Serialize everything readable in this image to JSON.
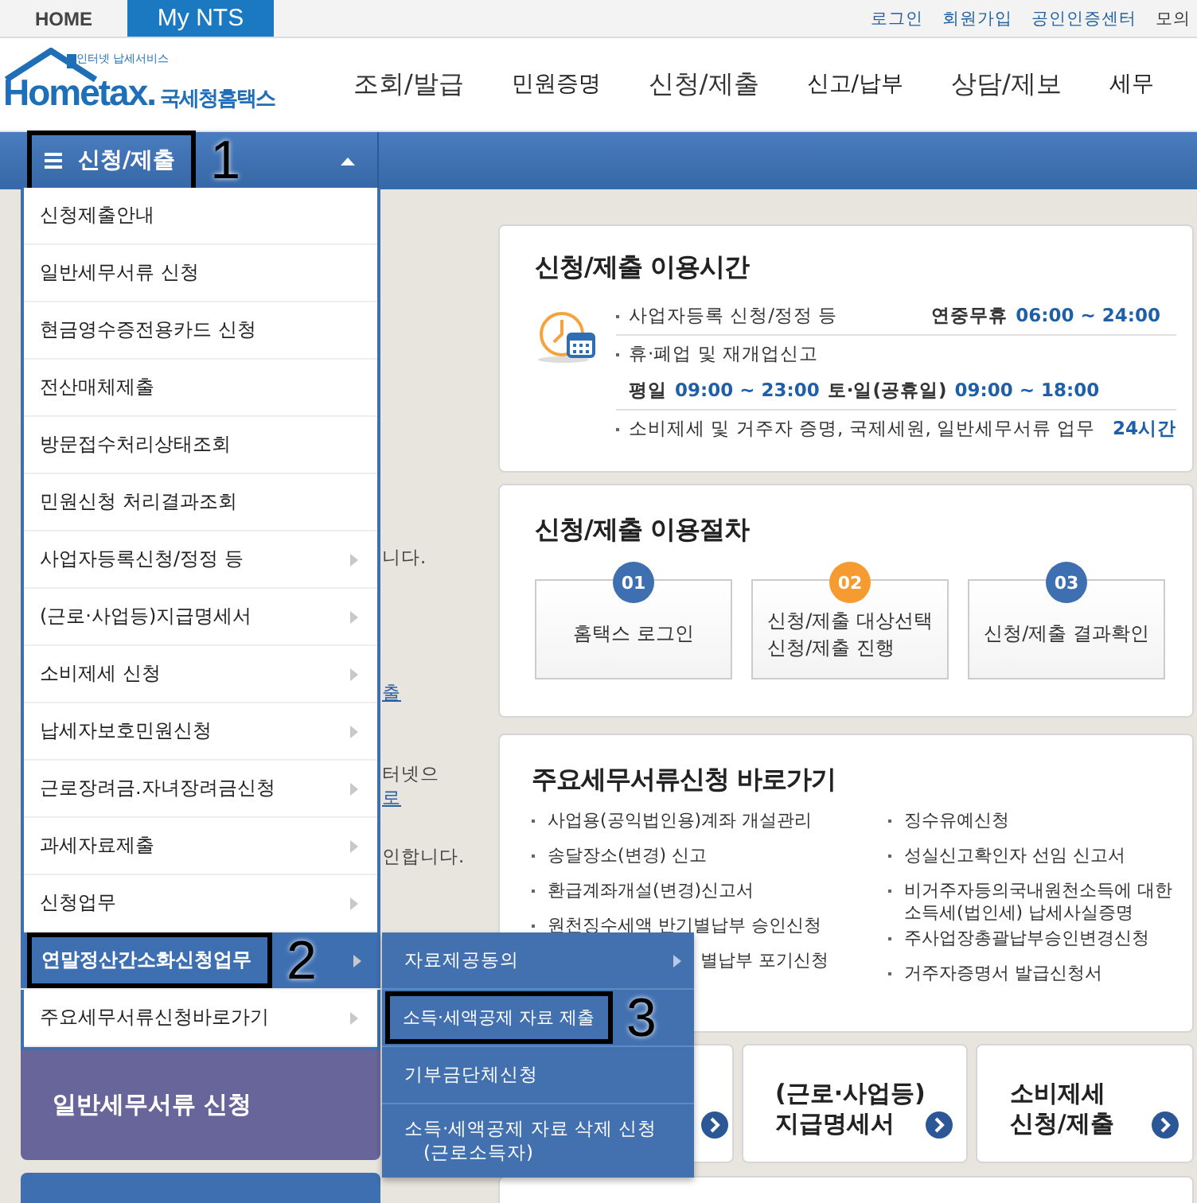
{
  "top_bar": {
    "tabs": [
      {
        "label": "HOME",
        "selected": false
      },
      {
        "label": "My NTS",
        "selected": true
      }
    ],
    "links": [
      "로그인",
      "회원가입",
      "공인인증센터",
      "모의"
    ]
  },
  "header": {
    "logo": {
      "brand": "Hometax.",
      "name": "국세청홈택스",
      "tagline": "인터넷 납세서비스"
    },
    "nav": [
      "조회/발급",
      "민원증명",
      "신청/제출",
      "신고/납부",
      "상담/제보",
      "세무"
    ]
  },
  "breadcrumb": {
    "label": "신청/제출",
    "annotation": "1"
  },
  "background_text": [
    {
      "text": "니다.",
      "kind": "plain"
    },
    {
      "text": "출",
      "kind": "link"
    },
    {
      "text": "터넷으",
      "kind": "plain"
    },
    {
      "text": "로",
      "kind": "link"
    },
    {
      "text": "인합니다.",
      "kind": "plain"
    }
  ],
  "left_cards": [
    {
      "label": "일반세무서류 신청",
      "color": "#67659a"
    },
    {
      "color": "#3e6fb1"
    }
  ],
  "menu": {
    "items": [
      {
        "label": "신청제출안내",
        "has_submenu": false,
        "selected": false
      },
      {
        "label": "일반세무서류 신청",
        "has_submenu": false,
        "selected": false
      },
      {
        "label": "현금영수증전용카드 신청",
        "has_submenu": false,
        "selected": false
      },
      {
        "label": "전산매체제출",
        "has_submenu": false,
        "selected": false
      },
      {
        "label": "방문접수처리상태조회",
        "has_submenu": false,
        "selected": false
      },
      {
        "label": "민원신청 처리결과조회",
        "has_submenu": false,
        "selected": false
      },
      {
        "label": "사업자등록신청/정정 등",
        "has_submenu": true,
        "selected": false
      },
      {
        "label": "(근로·사업등)지급명세서",
        "has_submenu": true,
        "selected": false
      },
      {
        "label": "소비제세 신청",
        "has_submenu": true,
        "selected": false
      },
      {
        "label": "납세자보호민원신청",
        "has_submenu": true,
        "selected": false
      },
      {
        "label": "근로장려금.자녀장려금신청",
        "has_submenu": true,
        "selected": false
      },
      {
        "label": "과세자료제출",
        "has_submenu": true,
        "selected": false
      },
      {
        "label": "신청업무",
        "has_submenu": true,
        "selected": false
      },
      {
        "label": "연말정산간소화신청업무",
        "has_submenu": true,
        "selected": true,
        "annotation": "2"
      },
      {
        "label": "주요세무서류신청바로가기",
        "has_submenu": true,
        "selected": false
      }
    ]
  },
  "submenu": {
    "items": [
      {
        "label": "자료제공동의",
        "has_submenu": true
      },
      {
        "label": "소득·세액공제 자료 제출",
        "has_submenu": false,
        "annotation": "3"
      },
      {
        "label": "기부금단체신청",
        "has_submenu": false
      },
      {
        "label": "소득·세액공제 자료 삭제 신청 　(근로소득자)",
        "has_submenu": false
      }
    ]
  },
  "hours": {
    "title": "신청/제출 이용시간",
    "rows": [
      {
        "label": "사업자등록 신청/정정 등",
        "value": [
          {
            "text": "연중무휴",
            "kind": "plain"
          },
          {
            "text": "06:00 ~ 24:00",
            "kind": "time"
          }
        ]
      },
      {
        "label": "휴·폐업 및 재개업신고",
        "detail": [
          {
            "text": "평일",
            "kind": "plain"
          },
          {
            "text": "09:00 ~ 23:00",
            "kind": "time"
          },
          {
            "text": "토·일(공휴일)",
            "kind": "plain"
          },
          {
            "text": "09:00 ~ 18:00",
            "kind": "time"
          }
        ]
      },
      {
        "label": "소비제세 및 거주자 증명, 국제세원, 일반세무서류 업무",
        "value": [
          {
            "text": "24시간",
            "kind": "time"
          }
        ]
      }
    ]
  },
  "procedure": {
    "title": "신청/제출 이용절차",
    "steps": [
      {
        "number": "01",
        "lines": [
          "홈택스 로그인"
        ],
        "color": "#3e6fb1"
      },
      {
        "number": "02",
        "lines": [
          "신청/제출 대상선택",
          "신청/제출 진행"
        ],
        "color": "#f59b30"
      },
      {
        "number": "03",
        "lines": [
          "신청/제출 결과확인"
        ],
        "color": "#3e6fb1"
      }
    ]
  },
  "shortcuts": {
    "title": "주요세무서류신청 바로가기",
    "columns": [
      [
        {
          "text": "사업용(공익법인용)계좌 개설관리",
          "kind": "link"
        },
        {
          "text": "송달장소(변경) 신고",
          "kind": "link"
        },
        {
          "text": "환급계좌개설(변경)신고서",
          "kind": "link"
        },
        {
          "text": "원천징수세액 반기별납부 승인신청",
          "kind": "link"
        },
        {
          "text": "별납부 포기신청",
          "kind": "partial"
        }
      ],
      [
        {
          "text": "징수유예신청",
          "kind": "link"
        },
        {
          "text": "성실신고확인자 선임 신고서",
          "kind": "link"
        },
        {
          "text": "비거주자등의국내원천소득에 대한 소득세(법인세) 납세사실증명",
          "kind": "link"
        },
        {
          "text": "주사업장총괄납부승인변경신청",
          "kind": "link"
        },
        {
          "text": "거주자증명서 발급신청서",
          "kind": "link"
        }
      ]
    ]
  },
  "tiles": [
    {
      "kind": "covered"
    },
    {
      "kind": "text",
      "lines": [
        "(근로·사업등)",
        "지급명세서"
      ]
    },
    {
      "kind": "text",
      "lines": [
        "소비제세",
        "신청/제출"
      ]
    }
  ]
}
